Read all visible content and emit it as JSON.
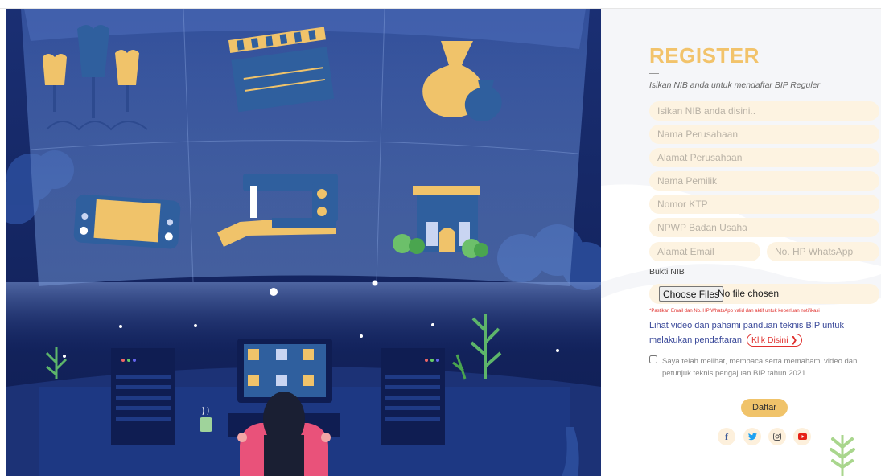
{
  "form": {
    "title": "REGISTER",
    "subtitle": "Isikan NIB anda untuk mendaftar BIP Reguler",
    "nib_placeholder": "Isikan NIB anda disini..",
    "company_name_placeholder": "Nama Perusahaan",
    "company_address_placeholder": "Alamat Perusahaan",
    "owner_name_placeholder": "Nama Pemilik",
    "ktp_placeholder": "Nomor KTP",
    "npwp_placeholder": "NPWP Badan Usaha",
    "email_placeholder": "Alamat Email",
    "whatsapp_placeholder": "No. HP WhatsApp",
    "bukti_label": "Bukti NIB",
    "choose_files_label": "Choose Files",
    "no_file_text": "No file chosen",
    "warning_text": "*Pastikan Email dan No. HP WhatsApp valid dan aktif untuk keperluan notifikasi",
    "guide_text": "Lihat video dan pahami panduan teknis BIP untuk melakukan pendaftaran.",
    "klik_label": "Klik Disini ❯",
    "agreement_text": "Saya telah melihat, membaca serta memahami video dan petunjuk teknis pengajuan BIP tahun 2021",
    "agreement_checked": false,
    "submit_label": "Daftar"
  },
  "social": {
    "facebook": "f",
    "twitter": "twitter-icon",
    "instagram": "instagram-icon",
    "youtube": "youtube-icon",
    "colors": {
      "facebook": "#3b5998",
      "twitter": "#1da1f2",
      "instagram": "#c13584",
      "youtube": "#e62117"
    }
  },
  "illustration": {
    "icons": [
      "mannequin-icon",
      "clapperboard-icon",
      "vase-icon",
      "game-console-icon",
      "sewing-machine-icon",
      "house-icon"
    ]
  },
  "colors": {
    "accent": "#f0c36a",
    "field_bg": "#fdf3e1",
    "title": "#f2c36b",
    "link": "#3b4a9a",
    "warning": "#e0312e",
    "night_bg": "#14245a"
  }
}
